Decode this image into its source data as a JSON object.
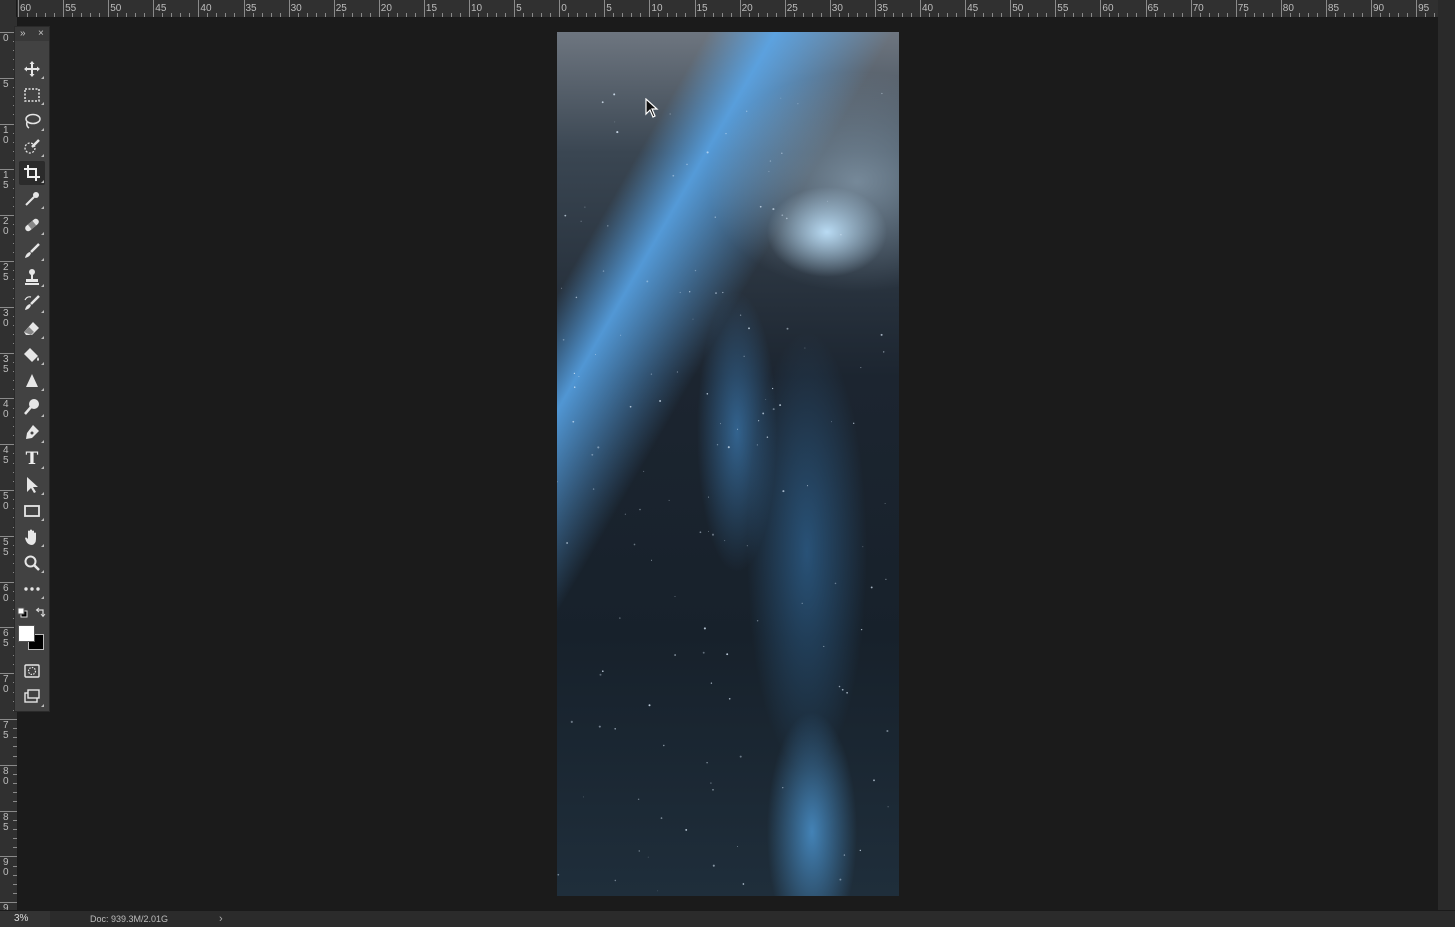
{
  "ruler": {
    "top_labels": [
      "60",
      "55",
      "50",
      "45",
      "40",
      "35",
      "30",
      "25",
      "20",
      "15",
      "10",
      "5",
      "0",
      "5",
      "10",
      "15",
      "20",
      "25",
      "30",
      "35",
      "40",
      "45",
      "50",
      "55",
      "60",
      "65",
      "70",
      "75",
      "80",
      "85",
      "90",
      "95"
    ],
    "left_labels": [
      "0",
      "5",
      "10",
      "15",
      "20",
      "25",
      "30",
      "35",
      "40",
      "45",
      "50",
      "55",
      "60",
      "65",
      "70",
      "75",
      "80",
      "85",
      "90",
      "95"
    ]
  },
  "toolbar": {
    "expand_glyph": "»",
    "close_glyph": "×",
    "tools": [
      {
        "name": "move-tool",
        "icon": "move-icon"
      },
      {
        "name": "marquee-tool",
        "icon": "marquee-icon"
      },
      {
        "name": "lasso-tool",
        "icon": "lasso-icon"
      },
      {
        "name": "quick-selection-tool",
        "icon": "quick-selection-icon"
      },
      {
        "name": "crop-tool",
        "icon": "crop-icon",
        "active": true
      },
      {
        "name": "eyedropper-tool",
        "icon": "eyedropper-icon"
      },
      {
        "name": "healing-brush-tool",
        "icon": "bandage-icon"
      },
      {
        "name": "brush-tool",
        "icon": "brush-icon"
      },
      {
        "name": "clone-stamp-tool",
        "icon": "stamp-icon"
      },
      {
        "name": "history-brush-tool",
        "icon": "history-brush-icon"
      },
      {
        "name": "eraser-tool",
        "icon": "eraser-icon"
      },
      {
        "name": "paint-bucket-tool",
        "icon": "paint-bucket-icon"
      },
      {
        "name": "blur-tool",
        "icon": "triangle-icon"
      },
      {
        "name": "dodge-tool",
        "icon": "dodge-icon"
      },
      {
        "name": "pen-tool",
        "icon": "pen-icon"
      },
      {
        "name": "type-tool",
        "icon": "type-icon",
        "glyph": "T"
      },
      {
        "name": "path-selection-tool",
        "icon": "arrow-icon"
      },
      {
        "name": "rectangle-tool",
        "icon": "rectangle-icon"
      },
      {
        "name": "hand-tool",
        "icon": "hand-icon"
      },
      {
        "name": "zoom-tool",
        "icon": "magnifier-icon"
      },
      {
        "name": "edit-toolbar",
        "icon": "more-icon"
      }
    ],
    "foreground_color": "#ffffff",
    "background_color": "#000000"
  },
  "status": {
    "zoom": "3%",
    "doc_info": "Doc: 939.3M/2.01G",
    "arrow": "›"
  }
}
